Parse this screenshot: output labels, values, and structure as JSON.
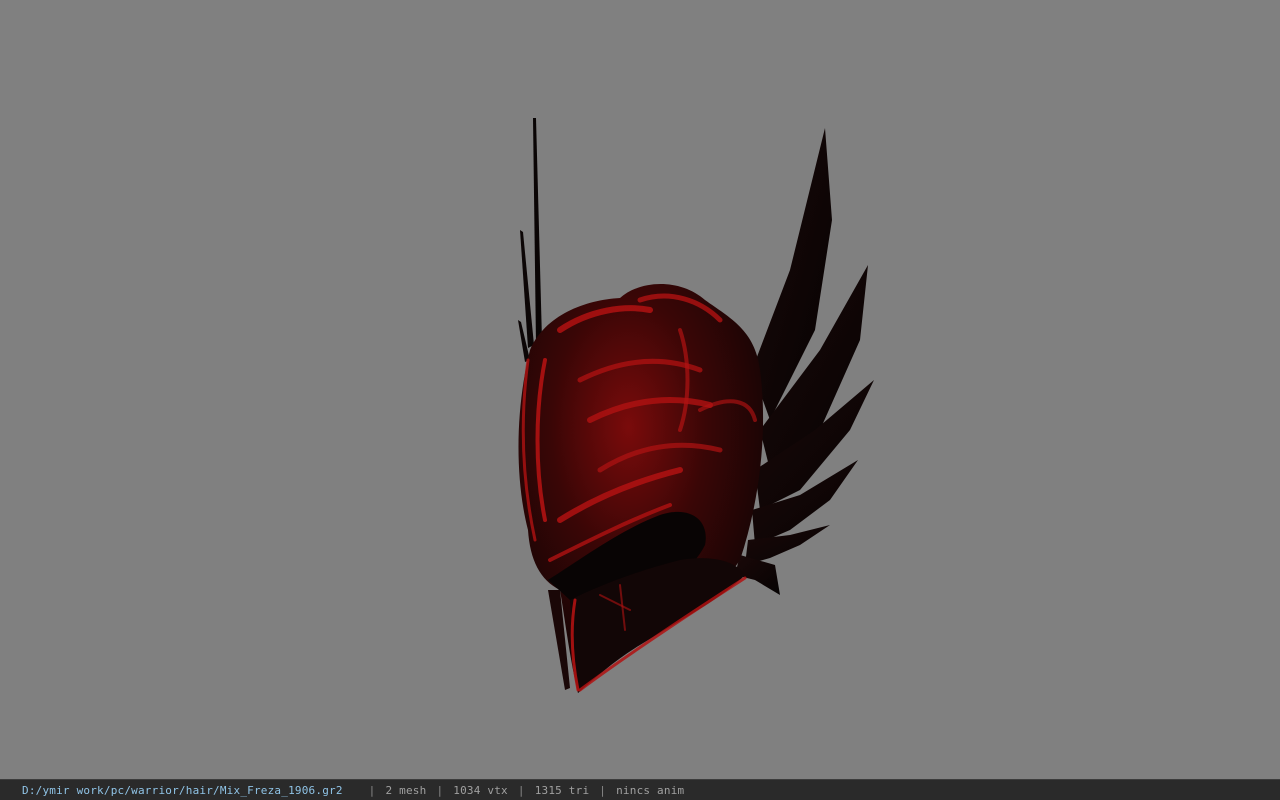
{
  "viewer": {
    "background_color": "#808080",
    "model": {
      "icon": "winged-helmet-model",
      "primary_color": "#0b0606",
      "accent_color": "#b01212"
    }
  },
  "status_bar": {
    "file_path": "D:/ymir work/pc/warrior/hair/Mix_Freza_1906.gr2",
    "separator": "|",
    "mesh_count": "2 mesh",
    "vertex_count": "1034 vtx",
    "triangle_count": "1315 tri",
    "anim_status": "nincs anim",
    "path_color": "#8fc3e6",
    "background_color": "#2a2a2a"
  }
}
